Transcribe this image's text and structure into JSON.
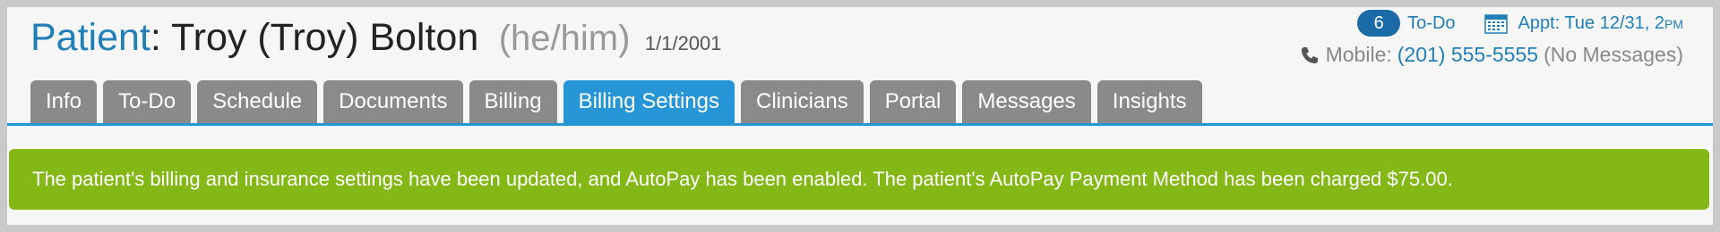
{
  "patient": {
    "prefix": "Patient",
    "separator": ": ",
    "name": "Troy (Troy) Bolton",
    "pronouns": "(he/him)",
    "dob": "1/1/2001"
  },
  "header_right": {
    "todo_count": "6",
    "todo_label": "To-Do",
    "appt_label": "Appt: Tue 12/31, 2",
    "appt_ampm": "PM",
    "mobile_label": "Mobile:",
    "mobile_number": "(201) 555-5555",
    "mobile_note": "(No Messages)"
  },
  "tabs": [
    {
      "label": "Info",
      "active": false
    },
    {
      "label": "To-Do",
      "active": false
    },
    {
      "label": "Schedule",
      "active": false
    },
    {
      "label": "Documents",
      "active": false
    },
    {
      "label": "Billing",
      "active": false
    },
    {
      "label": "Billing Settings",
      "active": true
    },
    {
      "label": "Clinicians",
      "active": false
    },
    {
      "label": "Portal",
      "active": false
    },
    {
      "label": "Messages",
      "active": false
    },
    {
      "label": "Insights",
      "active": false
    }
  ],
  "alert": {
    "message": "The patient's billing and insurance settings have been updated, and AutoPay has been enabled. The patient's AutoPay Payment Method has been charged $75.00."
  },
  "colors": {
    "brand_blue": "#1f7fb6",
    "active_tab": "#2796d6",
    "inactive_tab": "#8a8a8a",
    "success": "#84b817",
    "badge": "#1a6aa8"
  },
  "icons": [
    "calendar-icon",
    "phone-icon"
  ]
}
